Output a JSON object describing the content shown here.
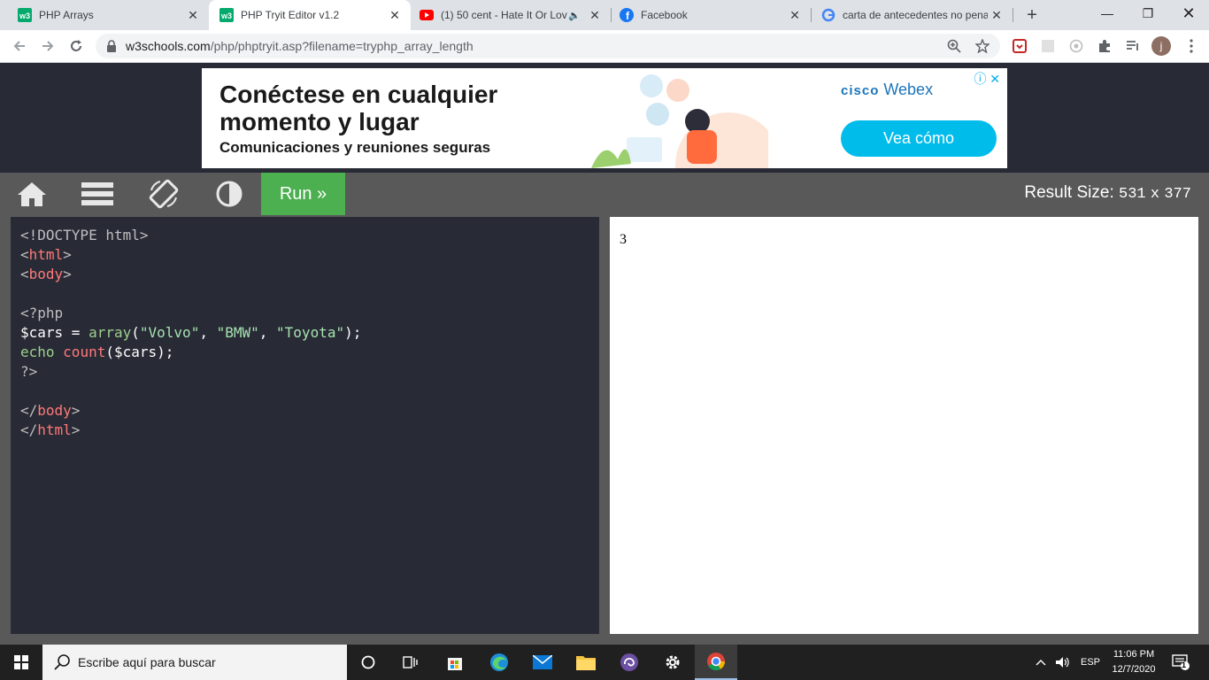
{
  "browser": {
    "tabs": [
      {
        "title": "PHP Arrays",
        "icon": "w3schools-icon"
      },
      {
        "title": "PHP Tryit Editor v1.2",
        "icon": "w3schools-icon"
      },
      {
        "title": "(1) 50 cent - Hate It Or Lov",
        "icon": "youtube-icon"
      },
      {
        "title": "Facebook",
        "icon": "facebook-icon"
      },
      {
        "title": "carta de antecedentes no penal",
        "icon": "google-icon"
      }
    ],
    "active_tab": 1,
    "url_host": "w3schools.com",
    "url_path": "/php/phptryit.asp?filename=tryphp_array_length",
    "profile_initial": "j"
  },
  "ad": {
    "headline": "Conéctese en cualquier momento y lugar",
    "subline": "Comunicaciones y reuniones seguras",
    "brand_prefix": "cisco",
    "brand": "Webex",
    "cta": "Vea cómo",
    "accent": "#00bceb"
  },
  "tryit": {
    "run_label": "Run »",
    "result_size_label": "Result Size:",
    "result_width": "531",
    "result_x": "x",
    "result_height": "377",
    "output": "3",
    "run_color": "#4caf50"
  },
  "code": {
    "doctype": "<!DOCTYPE html>",
    "html_open_lt": "<",
    "html_tag": "html",
    "body_tag": "body",
    "gt": ">",
    "php_open": "<?php",
    "var_cars": "$cars",
    "assign": " = ",
    "fn_array": "array",
    "args_open": "(",
    "str_volvo": "\"Volvo\"",
    "sep": ", ",
    "str_bmw": "\"BMW\"",
    "str_toyota": "\"Toyota\"",
    "args_close": ");",
    "kw_echo": "echo",
    "space": " ",
    "fn_count": "count",
    "count_args": "($cars);",
    "php_close": "?>",
    "close_lt": "</"
  },
  "taskbar": {
    "search_placeholder": "Escribe aquí para buscar",
    "language": "ESP",
    "time": "11:06 PM",
    "date": "12/7/2020",
    "notifications": "1"
  }
}
